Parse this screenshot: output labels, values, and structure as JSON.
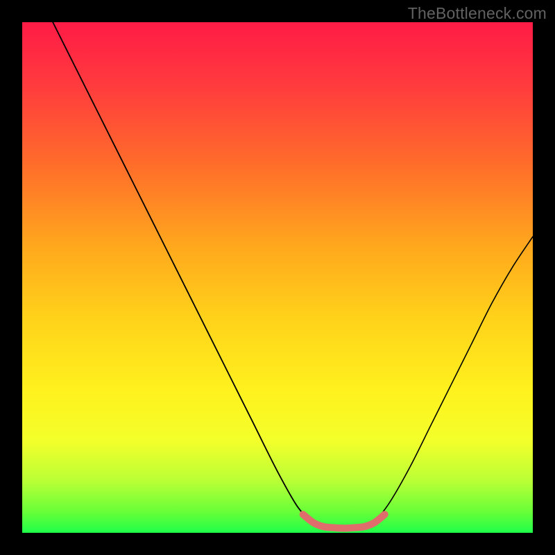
{
  "watermark": "TheBottleneck.com",
  "colors": {
    "frame": "#000000",
    "curve": "#000000",
    "accent_bump": "#df6d6b",
    "gradient_top": "#ff1b46",
    "gradient_mid": "#fff11e",
    "gradient_bottom": "#1fff4a"
  },
  "chart_data": {
    "type": "line",
    "title": "",
    "xlabel": "",
    "ylabel": "",
    "xlim": [
      0,
      100
    ],
    "ylim": [
      0,
      100
    ],
    "grid": false,
    "legend": false,
    "annotations": [],
    "series": [
      {
        "name": "left-descending-curve",
        "x": [
          6,
          10,
          15,
          20,
          25,
          30,
          35,
          40,
          45,
          50,
          54,
          57
        ],
        "values": [
          100,
          92,
          82,
          72,
          62,
          52,
          42,
          32,
          22,
          12,
          5,
          2
        ]
      },
      {
        "name": "valley-bump",
        "x": [
          55,
          57,
          59,
          61,
          63,
          65,
          67,
          69,
          71
        ],
        "values": [
          3.6,
          2.0,
          1.2,
          1.0,
          0.9,
          1.0,
          1.2,
          2.0,
          3.6
        ]
      },
      {
        "name": "right-ascending-curve",
        "x": [
          69,
          72,
          76,
          80,
          84,
          88,
          92,
          96,
          100
        ],
        "values": [
          2,
          6,
          13,
          21,
          29,
          37,
          45,
          52,
          58
        ]
      }
    ]
  }
}
